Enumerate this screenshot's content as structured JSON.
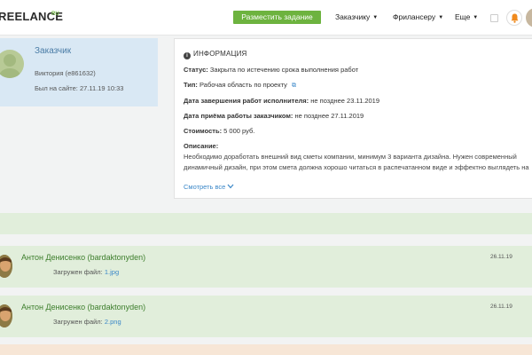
{
  "header": {
    "logo_text": "REELANCE",
    "logo_suffix": "RU",
    "post_task_button": "Разместить задание",
    "menu": [
      {
        "label": "Заказчику"
      },
      {
        "label": "Фрилансеру"
      },
      {
        "label": "Еще"
      }
    ],
    "accent_color": "#6db33f"
  },
  "customer": {
    "title": "Заказчик",
    "name": "Виктория (e861632)",
    "last_seen": "Был на сайте: 27.11.19 10:33"
  },
  "info": {
    "heading": "ИНФОРМАЦИЯ",
    "status_label": "Статус:",
    "status_value": "Закрыта по истечению срока выполнения работ",
    "type_label": "Тип:",
    "type_value": "Рабочая область по проекту",
    "deadline_label": "Дата завершения работ исполнителя:",
    "deadline_value": "не позднее 23.11.2019",
    "acceptance_label": "Дата приёма работы заказчиком:",
    "acceptance_value": "не позднее 27.11.2019",
    "cost_label": "Стоимость:",
    "cost_value": "5 000 руб.",
    "description_label": "Описание:",
    "description_text": "Необходимо доработать внешний вид сметы компании, минимум 3 варианта дизайна. Нужен современный динамичный дизайн, при этом смета должна хорошо читаться в распечатанном виде и эффектно выглядеть на экране.",
    "see_all": "Смотреть все"
  },
  "feed": {
    "messages": [
      {
        "author": "Антон Денисенко (bardaktonyden)",
        "file_label": "Загружен файл:",
        "file_name": "1.jpg",
        "date": "26.11.19"
      },
      {
        "author": "Антон Денисенко (bardaktonyden)",
        "file_label": "Загружен файл:",
        "file_name": "2.png",
        "date": "26.11.19"
      }
    ]
  }
}
